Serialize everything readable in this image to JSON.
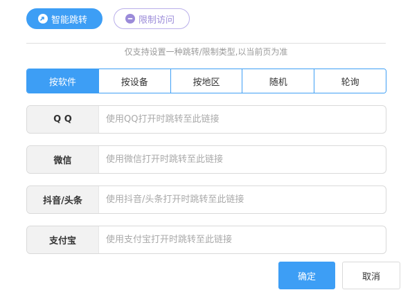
{
  "mode_tabs": [
    {
      "label": "智能跳转",
      "icon": "redirect-icon",
      "active": true
    },
    {
      "label": "限制访问",
      "icon": "minus-circle-icon",
      "active": false
    }
  ],
  "hint": "仅支持设置一种跳转/限制类型,以当前页为准",
  "type_tabs": [
    {
      "label": "按软件",
      "active": true
    },
    {
      "label": "按设备",
      "active": false
    },
    {
      "label": "按地区",
      "active": false
    },
    {
      "label": "随机",
      "active": false
    },
    {
      "label": "轮询",
      "active": false
    }
  ],
  "fields": [
    {
      "label": "Q Q",
      "value": "",
      "placeholder": "使用QQ打开时跳转至此链接"
    },
    {
      "label": "微信",
      "value": "",
      "placeholder": "使用微信打开时跳转至此链接"
    },
    {
      "label": "抖音/头条",
      "value": "",
      "placeholder": "使用抖音/头条打开时跳转至此链接"
    },
    {
      "label": "支付宝",
      "value": "",
      "placeholder": "使用支付宝打开时跳转至此链接"
    }
  ],
  "buttons": {
    "ok": "确定",
    "cancel": "取消"
  },
  "colors": {
    "accent": "#3d9ef5",
    "secondary": "#9b8bd9"
  }
}
